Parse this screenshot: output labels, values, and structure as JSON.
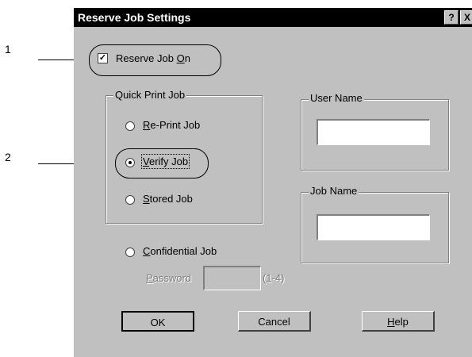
{
  "callouts": {
    "one": "1",
    "two": "2"
  },
  "dialog": {
    "title": "Reserve Job Settings",
    "help_btn": "?",
    "close_btn": "X",
    "reserve_job": {
      "checked": true,
      "label_pre": "Reserve Job ",
      "label_acc": "O",
      "label_post": "n"
    },
    "quick_print": {
      "title": "Quick Print Job",
      "reprint": {
        "acc": "R",
        "rest": "e-Print Job"
      },
      "verify": {
        "acc": "V",
        "rest": "erify Job",
        "selected": true
      },
      "stored": {
        "acc": "S",
        "rest": "tored Job"
      }
    },
    "confidential": {
      "acc": "C",
      "rest": "onfidential Job"
    },
    "password": {
      "acc": "P",
      "rest": "assword",
      "hint": "(1-4)",
      "value": ""
    },
    "user_name": {
      "title": "User Name",
      "value": ""
    },
    "job_name": {
      "title": "Job Name",
      "value": ""
    },
    "buttons": {
      "ok": "OK",
      "cancel": "Cancel",
      "help_acc": "H",
      "help_rest": "elp"
    }
  }
}
